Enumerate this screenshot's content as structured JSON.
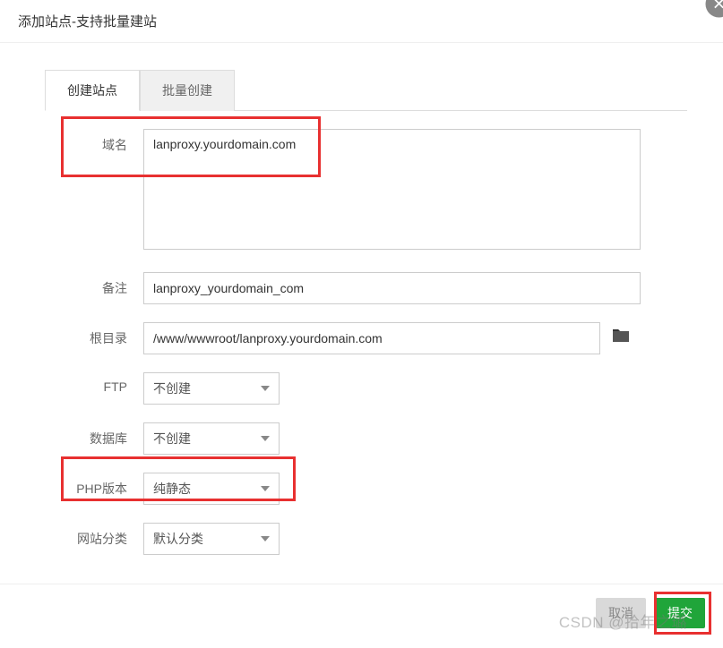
{
  "modal": {
    "title": "添加站点-支持批量建站"
  },
  "tabs": {
    "create": "创建站点",
    "batch": "批量创建"
  },
  "form": {
    "domain": {
      "label": "域名",
      "value": "lanproxy.yourdomain.com"
    },
    "remark": {
      "label": "备注",
      "value": "lanproxy_yourdomain_com"
    },
    "root": {
      "label": "根目录",
      "value": "/www/wwwroot/lanproxy.yourdomain.com"
    },
    "ftp": {
      "label": "FTP",
      "value": "不创建"
    },
    "db": {
      "label": "数据库",
      "value": "不创建"
    },
    "php": {
      "label": "PHP版本",
      "value": "纯静态"
    },
    "cat": {
      "label": "网站分类",
      "value": "默认分类"
    }
  },
  "footer": {
    "cancel": "取消",
    "submit": "提交"
  },
  "watermark": "CSDN @拾年之璐"
}
